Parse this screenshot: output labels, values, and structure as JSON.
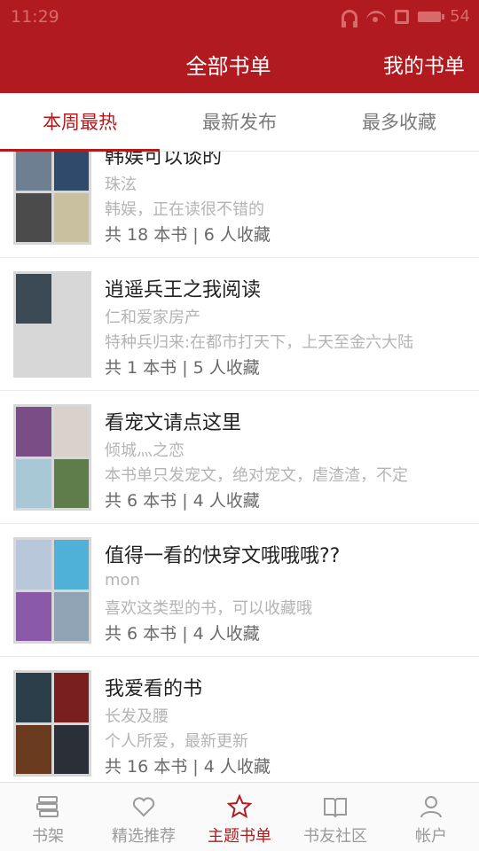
{
  "status_bar": {
    "time": "11:29",
    "battery": "54"
  },
  "header": {
    "title": "全部书单",
    "right_action": "我的书单"
  },
  "tabs": [
    {
      "label": "本周最热",
      "active": true
    },
    {
      "label": "最新发布",
      "active": false
    },
    {
      "label": "最多收藏",
      "active": false
    }
  ],
  "lists": [
    {
      "title": "韩娱可以谈的",
      "author": "珠泫",
      "description": "韩娱，正在读很不错的",
      "stats": "共 18 本书 | 6 人收藏",
      "cover_colors": [
        "#6e7f92",
        "#2f4a6a",
        "#4b4b4b",
        "#c9c0a0"
      ]
    },
    {
      "title": "逍遥兵王之我阅读",
      "author": "仁和爱家房产",
      "description": "特种兵归来:在都市打天下，上天至金六大陆",
      "stats": "共 1 本书 | 5 人收藏",
      "cover_colors": [
        "#3c4a56",
        "",
        "",
        ""
      ]
    },
    {
      "title": "看宠文请点这里",
      "author": "倾城灬之恋",
      "description": "本书单只发宠文，绝对宠文，虐渣渣，不定",
      "stats": "共 6 本书 | 4 人收藏",
      "cover_colors": [
        "#7a4d86",
        "#d9d2cc",
        "#a9c8d6",
        "#5f7d4a"
      ]
    },
    {
      "title": "值得一看的快穿文哦哦哦??",
      "author": "mon",
      "description": "喜欢这类型的书，可以收藏哦",
      "stats": "共 6 本书 | 4 人收藏",
      "cover_colors": [
        "#b8c7d9",
        "#4fb0d8",
        "#8a5aa8",
        "#8fa3b5"
      ]
    },
    {
      "title": "我爱看的书",
      "author": "长发及腰",
      "description": "个人所爱，最新更新",
      "stats": "共 16 本书 | 4 人收藏",
      "cover_colors": [
        "#2c3e4a",
        "#7a1f1f",
        "#6a3a1f",
        "#2a2f38"
      ]
    }
  ],
  "bottom_nav": [
    {
      "label": "书架",
      "icon": "bookshelf-icon",
      "active": false
    },
    {
      "label": "精选推荐",
      "icon": "heart-icon",
      "active": false
    },
    {
      "label": "主题书单",
      "icon": "star-icon",
      "active": true
    },
    {
      "label": "书友社区",
      "icon": "book-icon",
      "active": false
    },
    {
      "label": "帐户",
      "icon": "user-icon",
      "active": false
    }
  ],
  "colors": {
    "brand": "#b11b1f",
    "muted": "#b4b4b4"
  }
}
